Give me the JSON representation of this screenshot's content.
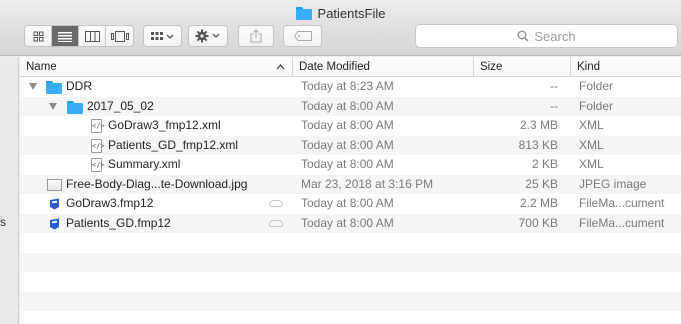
{
  "window": {
    "title": "PatientsFile"
  },
  "toolbar": {
    "view_modes": [
      "icon-view-icon",
      "list-view-icon",
      "column-view-icon",
      "cover-flow-icon"
    ],
    "active_view": 1,
    "group_icon": "group-by-icon",
    "action_icon": "gear-icon",
    "share_icon": "share-icon",
    "tag_icon": "tag-icon"
  },
  "search": {
    "placeholder": "Search"
  },
  "sidebar": {
    "partial_text": "s"
  },
  "columns": {
    "name": "Name",
    "date": "Date Modified",
    "size": "Size",
    "kind": "Kind"
  },
  "rows": [
    {
      "name": "DDR",
      "date": "Today at 8:23 AM",
      "size": "--",
      "kind": "Folder",
      "icon": "folder-icon",
      "level": 0,
      "expanded": true
    },
    {
      "name": "2017_05_02",
      "date": "Today at 8:00 AM",
      "size": "--",
      "kind": "Folder",
      "icon": "folder-icon",
      "level": 1,
      "expanded": true
    },
    {
      "name": "GoDraw3_fmp12.xml",
      "date": "Today at 8:00 AM",
      "size": "2.3 MB",
      "kind": "XML",
      "icon": "xml-file-icon",
      "level": 2
    },
    {
      "name": "Patients_GD_fmp12.xml",
      "date": "Today at 8:00 AM",
      "size": "813 KB",
      "kind": "XML",
      "icon": "xml-file-icon",
      "level": 2
    },
    {
      "name": "Summary.xml",
      "date": "Today at 8:00 AM",
      "size": "2 KB",
      "kind": "XML",
      "icon": "xml-file-icon",
      "level": 2
    },
    {
      "name": "Free-Body-Diag...te-Download.jpg",
      "date": "Mar 23, 2018 at 3:16 PM",
      "size": "25 KB",
      "kind": "JPEG image",
      "icon": "image-file-icon",
      "level": 0
    },
    {
      "name": "GoDraw3.fmp12",
      "date": "Today at 8:00 AM",
      "size": "2.2 MB",
      "kind": "FileMa...cument",
      "icon": "filemaker-file-icon",
      "level": 0,
      "cloud": true
    },
    {
      "name": "Patients_GD.fmp12",
      "date": "Today at 8:00 AM",
      "size": "700 KB",
      "kind": "FileMa...cument",
      "icon": "filemaker-file-icon",
      "level": 0,
      "cloud": true
    }
  ]
}
